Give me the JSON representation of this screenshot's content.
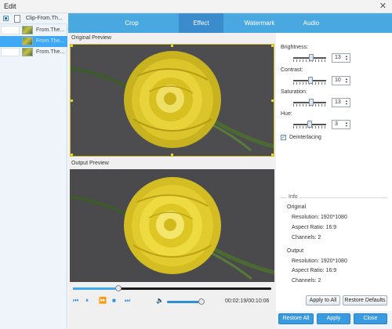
{
  "window": {
    "title": "Edit",
    "close_glyph": "✕"
  },
  "sidebar": {
    "header_text": "Clip-From.Th...",
    "items": [
      {
        "label": "From.The...",
        "icon": "video-thumbnail"
      },
      {
        "label": "From.The...",
        "icon": "video-thumbnail"
      },
      {
        "label": "From.The...",
        "icon": "video-thumbnail"
      }
    ]
  },
  "tabs": [
    "Crop",
    "Effect",
    "Watermark",
    "Audio"
  ],
  "active_tab": "Effect",
  "preview": {
    "original_label": "Original Preview",
    "output_label": "Output Preview",
    "seek_progress": 0.23,
    "volume_level": 0.92,
    "time": "00:02:19/00:10:06"
  },
  "adjustments": {
    "brightness": {
      "label": "Brightness:",
      "value": "13",
      "position": 0.56
    },
    "contrast": {
      "label": "Contrast:",
      "value": "10",
      "position": 0.54
    },
    "saturation": {
      "label": "Saturation:",
      "value": "13",
      "position": 0.56
    },
    "hue": {
      "label": "Hue:",
      "value": "3",
      "position": 0.51
    }
  },
  "deinterlacing": {
    "label": "Deinterlacing",
    "checked": true
  },
  "info": {
    "title": "Info",
    "original": {
      "heading": "Original",
      "resolution": "Resolution: 1920*1080",
      "aspect_ratio": "Aspect Ratio: 16:9",
      "channels": "Channels: 2"
    },
    "output": {
      "heading": "Output",
      "resolution": "Resolution: 1920*1080",
      "aspect_ratio": "Aspect Ratio: 16:9",
      "channels": "Channels: 2"
    }
  },
  "buttons": {
    "apply_to_all": "Apply to All",
    "restore_defaults": "Restore Defaults",
    "restore_all": "Restore All",
    "apply": "Apply",
    "close": "Close"
  },
  "colors": {
    "accent": "#3fa9f5",
    "tab_bar": "#4aa8e0",
    "tab_active": "#3a8ccc",
    "button_blue": "#3a9ae0",
    "crop_frame": "#c9b82e"
  }
}
